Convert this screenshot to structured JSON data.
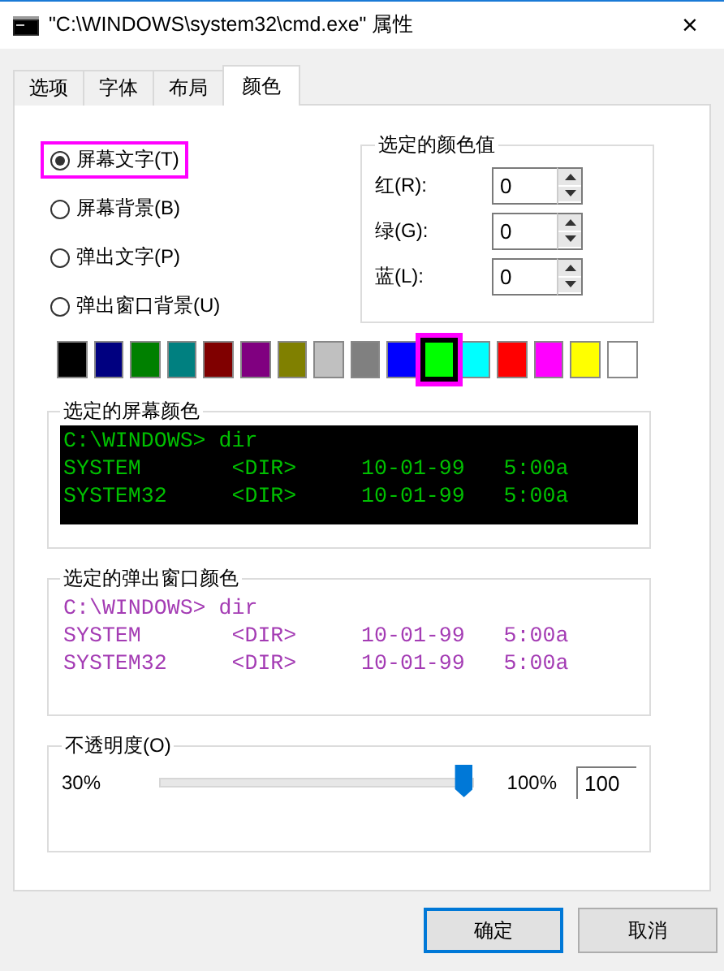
{
  "window": {
    "title": "\"C:\\WINDOWS\\system32\\cmd.exe\" 属性",
    "close": "×"
  },
  "tabs": [
    {
      "label": "选项",
      "selected": false
    },
    {
      "label": "字体",
      "selected": false
    },
    {
      "label": "布局",
      "selected": false
    },
    {
      "label": "颜色",
      "selected": true
    }
  ],
  "radios": [
    {
      "label": "屏幕文字(T)",
      "selected": true,
      "highlighted": true
    },
    {
      "label": "屏幕背景(B)",
      "selected": false,
      "highlighted": false
    },
    {
      "label": "弹出文字(P)",
      "selected": false,
      "highlighted": false
    },
    {
      "label": "弹出窗口背景(U)",
      "selected": false,
      "highlighted": false
    }
  ],
  "color_values": {
    "title": "选定的颜色值",
    "fields": [
      {
        "label": "红(R):",
        "value": "0"
      },
      {
        "label": "绿(G):",
        "value": "0"
      },
      {
        "label": "蓝(L):",
        "value": "0"
      }
    ]
  },
  "swatches": [
    {
      "color": "#000000",
      "selected": false,
      "highlighted": false
    },
    {
      "color": "#000080",
      "selected": false,
      "highlighted": false
    },
    {
      "color": "#008000",
      "selected": false,
      "highlighted": false
    },
    {
      "color": "#008080",
      "selected": false,
      "highlighted": false
    },
    {
      "color": "#800000",
      "selected": false,
      "highlighted": false
    },
    {
      "color": "#800080",
      "selected": false,
      "highlighted": false
    },
    {
      "color": "#808000",
      "selected": false,
      "highlighted": false
    },
    {
      "color": "#c0c0c0",
      "selected": false,
      "highlighted": false
    },
    {
      "color": "#808080",
      "selected": false,
      "highlighted": false
    },
    {
      "color": "#0000ff",
      "selected": false,
      "highlighted": false
    },
    {
      "color": "#00ff00",
      "selected": true,
      "highlighted": true
    },
    {
      "color": "#00ffff",
      "selected": false,
      "highlighted": false
    },
    {
      "color": "#ff0000",
      "selected": false,
      "highlighted": false
    },
    {
      "color": "#ff00ff",
      "selected": false,
      "highlighted": false
    },
    {
      "color": "#ffff00",
      "selected": false,
      "highlighted": false
    },
    {
      "color": "#ffffff",
      "selected": false,
      "highlighted": false
    }
  ],
  "previews": [
    {
      "title": "选定的屏幕颜色",
      "kind": "screen",
      "lines": [
        "C:\\WINDOWS> dir",
        "SYSTEM       <DIR>     10-01-99   5:00a",
        "SYSTEM32     <DIR>     10-01-99   5:00a"
      ]
    },
    {
      "title": "选定的弹出窗口颜色",
      "kind": "popup",
      "lines": [
        "C:\\WINDOWS> dir",
        "SYSTEM       <DIR>     10-01-99   5:00a",
        "SYSTEM32     <DIR>     10-01-99   5:00a"
      ]
    }
  ],
  "opacity": {
    "title": "不透明度(O)",
    "min_label": "30%",
    "max_label": "100%",
    "level": 1,
    "value": "100"
  },
  "buttons": [
    {
      "label": "确定",
      "default": true
    },
    {
      "label": "取消",
      "default": false
    }
  ]
}
